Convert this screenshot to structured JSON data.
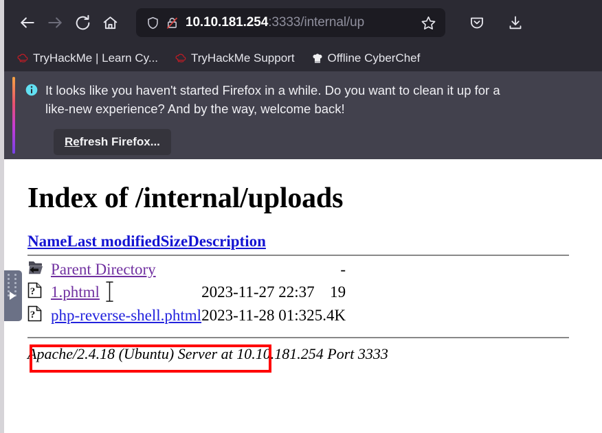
{
  "browser": {
    "toolbar": {
      "back_label": "Back",
      "forward_label": "Forward",
      "reload_label": "Reload",
      "home_label": "Home",
      "pocket_label": "Save to Pocket",
      "downloads_label": "Downloads",
      "bookmark_star_label": "Bookmark this page"
    },
    "urlbar": {
      "host": "10.10.181.254",
      "path": ":3333/internal/up",
      "full_value": "10.10.181.254:3333/internal/up",
      "shield_label": "Enhanced Tracking Protection",
      "lock_label": "Connection is not secure"
    },
    "bookmarks": [
      {
        "label": "TryHackMe | Learn Cy...",
        "icon": "tryhackme-icon"
      },
      {
        "label": "TryHackMe Support",
        "icon": "tryhackme-icon"
      },
      {
        "label": "Offline CyberChef",
        "icon": "chefhat-icon"
      }
    ]
  },
  "notification": {
    "icon": "info-icon",
    "line1": "It looks like you haven't started Firefox in a while. Do you want to clean it up for a",
    "line2": "like-new experience? And by the way, welcome back!",
    "button_prefix": "R",
    "button_accesskey": "e",
    "button_suffix": "fresh Firefox...",
    "accent_colors": [
      "#f7a442",
      "#e8516e",
      "#c63bd6",
      "#7542e6"
    ]
  },
  "page": {
    "title": "Index of /internal/uploads",
    "columns": [
      {
        "label": "Name",
        "key": "name"
      },
      {
        "label": "Last modified",
        "key": "modified"
      },
      {
        "label": "Size",
        "key": "size"
      },
      {
        "label": "Description",
        "key": "description"
      }
    ],
    "rows": [
      {
        "icon": "parent-directory-icon",
        "name": "Parent Directory",
        "modified": "",
        "size": "-",
        "description": "",
        "visited": true
      },
      {
        "icon": "unknown-file-icon",
        "name": "1.phtml",
        "modified": "2023-11-27 22:37",
        "size": "19",
        "description": "",
        "visited": true
      },
      {
        "icon": "unknown-file-icon",
        "name": "php-reverse-shell.phtml",
        "modified": "2023-11-28 01:32",
        "size": "5.4K",
        "description": "",
        "visited": true
      }
    ],
    "footer": "Apache/2.4.18 (Ubuntu) Server at 10.10.181.254 Port 3333"
  },
  "annotation": {
    "color": "#ff0000",
    "target": "php-reverse-shell.phtml"
  }
}
